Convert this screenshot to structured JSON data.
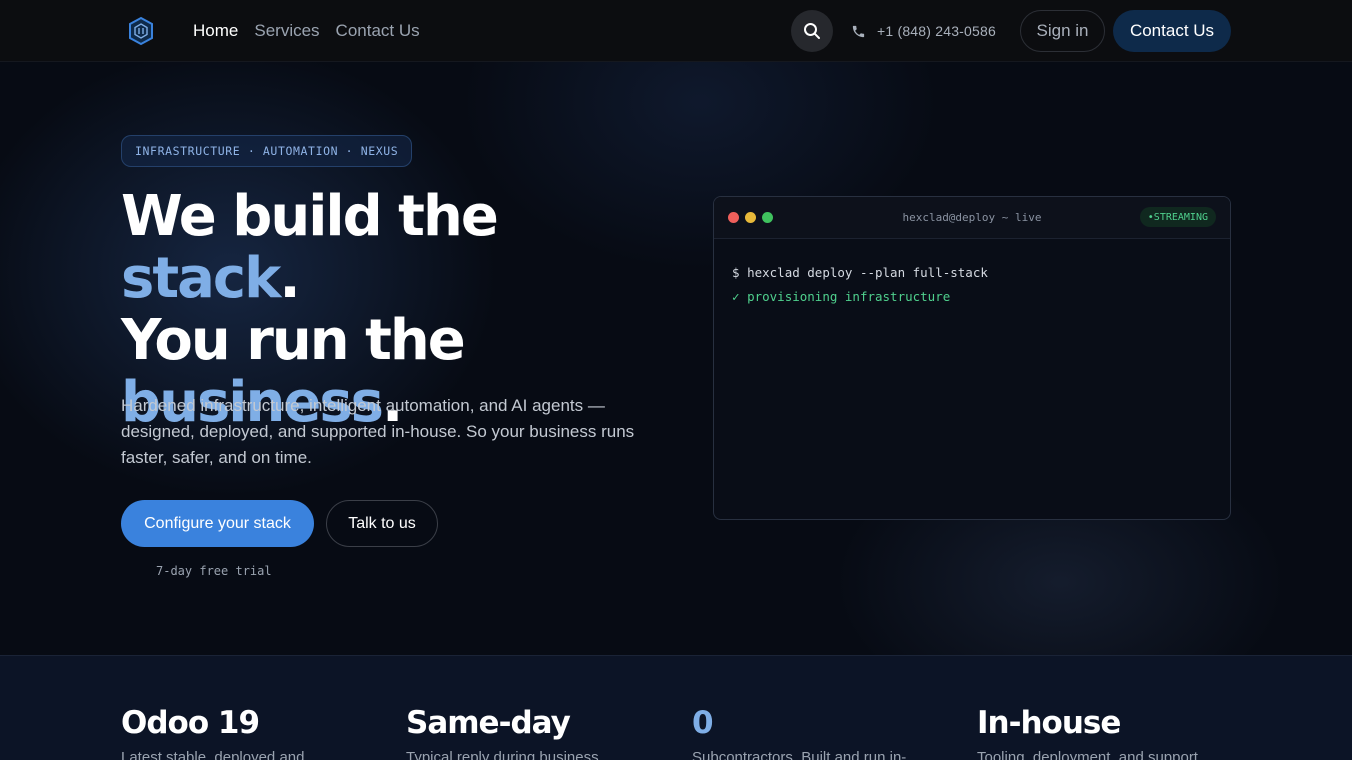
{
  "nav": {
    "logo_icon": "hexagon-logo-icon",
    "links": [
      {
        "label": "Home",
        "active": true
      },
      {
        "label": "Services",
        "active": false
      },
      {
        "label": "Contact Us",
        "active": false
      }
    ],
    "search_icon": "search-icon",
    "phone_icon": "phone-icon",
    "phone": "+1 (848) 243-0586",
    "signin_label": "Sign in",
    "contact_label": "Contact Us"
  },
  "hero": {
    "badge": "INFRASTRUCTURE · AUTOMATION · NEXUS",
    "headline": {
      "part1": "We build the ",
      "accent1": "stack",
      "part2": ".",
      "line2": "You run the",
      "accent2": "business",
      "part3": "."
    },
    "lede": "Hardened infrastructure, intelligent automation, and AI agents — designed, deployed, and supported in-house. So your business runs faster, safer, and on time.",
    "primary_cta": "Configure your stack",
    "secondary_cta": "Talk to us",
    "trial_note": "7-day free trial"
  },
  "terminal": {
    "title": "hexclad@deploy ~ live",
    "status": "•STREAMING",
    "lines": [
      {
        "prefix": "$",
        "text": "hexclad deploy --plan full-stack"
      },
      {
        "prefix": "✓",
        "text": "provisioning infrastructure"
      }
    ]
  },
  "stats": [
    {
      "value": "Odoo 19",
      "desc": "Latest stable, deployed and",
      "accent": false
    },
    {
      "value": "Same-day",
      "desc": "Typical reply during business",
      "accent": false
    },
    {
      "value": "0",
      "desc": "Subcontractors. Built and run in-",
      "accent": true
    },
    {
      "value": "In-house",
      "desc": "Tooling, deployment, and support",
      "accent": false
    }
  ],
  "colors": {
    "accent": "#7faee6",
    "primary_button": "#3a82dd",
    "contact_button": "#0e2a4a",
    "success": "#4fd08d",
    "background": "#070b14"
  }
}
